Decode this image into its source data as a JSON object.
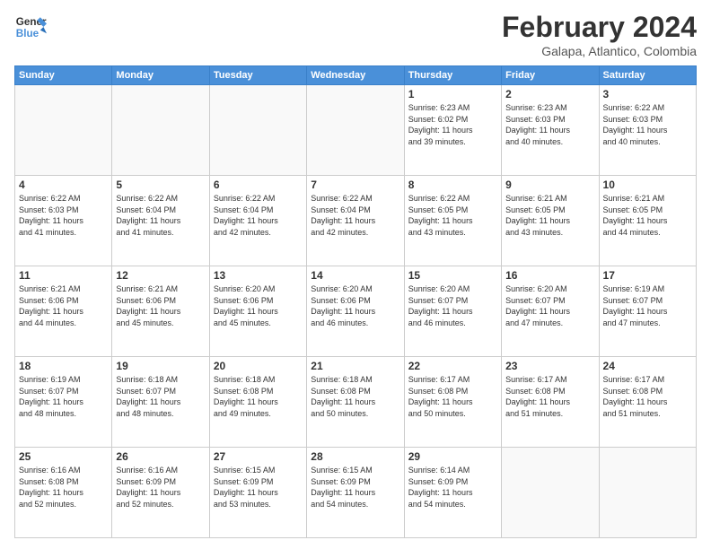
{
  "header": {
    "logo_line1": "General",
    "logo_line2": "Blue",
    "title": "February 2024",
    "subtitle": "Galapa, Atlantico, Colombia"
  },
  "days_of_week": [
    "Sunday",
    "Monday",
    "Tuesday",
    "Wednesday",
    "Thursday",
    "Friday",
    "Saturday"
  ],
  "weeks": [
    [
      {
        "day": "",
        "info": ""
      },
      {
        "day": "",
        "info": ""
      },
      {
        "day": "",
        "info": ""
      },
      {
        "day": "",
        "info": ""
      },
      {
        "day": "1",
        "info": "Sunrise: 6:23 AM\nSunset: 6:02 PM\nDaylight: 11 hours\nand 39 minutes."
      },
      {
        "day": "2",
        "info": "Sunrise: 6:23 AM\nSunset: 6:03 PM\nDaylight: 11 hours\nand 40 minutes."
      },
      {
        "day": "3",
        "info": "Sunrise: 6:22 AM\nSunset: 6:03 PM\nDaylight: 11 hours\nand 40 minutes."
      }
    ],
    [
      {
        "day": "4",
        "info": "Sunrise: 6:22 AM\nSunset: 6:03 PM\nDaylight: 11 hours\nand 41 minutes."
      },
      {
        "day": "5",
        "info": "Sunrise: 6:22 AM\nSunset: 6:04 PM\nDaylight: 11 hours\nand 41 minutes."
      },
      {
        "day": "6",
        "info": "Sunrise: 6:22 AM\nSunset: 6:04 PM\nDaylight: 11 hours\nand 42 minutes."
      },
      {
        "day": "7",
        "info": "Sunrise: 6:22 AM\nSunset: 6:04 PM\nDaylight: 11 hours\nand 42 minutes."
      },
      {
        "day": "8",
        "info": "Sunrise: 6:22 AM\nSunset: 6:05 PM\nDaylight: 11 hours\nand 43 minutes."
      },
      {
        "day": "9",
        "info": "Sunrise: 6:21 AM\nSunset: 6:05 PM\nDaylight: 11 hours\nand 43 minutes."
      },
      {
        "day": "10",
        "info": "Sunrise: 6:21 AM\nSunset: 6:05 PM\nDaylight: 11 hours\nand 44 minutes."
      }
    ],
    [
      {
        "day": "11",
        "info": "Sunrise: 6:21 AM\nSunset: 6:06 PM\nDaylight: 11 hours\nand 44 minutes."
      },
      {
        "day": "12",
        "info": "Sunrise: 6:21 AM\nSunset: 6:06 PM\nDaylight: 11 hours\nand 45 minutes."
      },
      {
        "day": "13",
        "info": "Sunrise: 6:20 AM\nSunset: 6:06 PM\nDaylight: 11 hours\nand 45 minutes."
      },
      {
        "day": "14",
        "info": "Sunrise: 6:20 AM\nSunset: 6:06 PM\nDaylight: 11 hours\nand 46 minutes."
      },
      {
        "day": "15",
        "info": "Sunrise: 6:20 AM\nSunset: 6:07 PM\nDaylight: 11 hours\nand 46 minutes."
      },
      {
        "day": "16",
        "info": "Sunrise: 6:20 AM\nSunset: 6:07 PM\nDaylight: 11 hours\nand 47 minutes."
      },
      {
        "day": "17",
        "info": "Sunrise: 6:19 AM\nSunset: 6:07 PM\nDaylight: 11 hours\nand 47 minutes."
      }
    ],
    [
      {
        "day": "18",
        "info": "Sunrise: 6:19 AM\nSunset: 6:07 PM\nDaylight: 11 hours\nand 48 minutes."
      },
      {
        "day": "19",
        "info": "Sunrise: 6:18 AM\nSunset: 6:07 PM\nDaylight: 11 hours\nand 48 minutes."
      },
      {
        "day": "20",
        "info": "Sunrise: 6:18 AM\nSunset: 6:08 PM\nDaylight: 11 hours\nand 49 minutes."
      },
      {
        "day": "21",
        "info": "Sunrise: 6:18 AM\nSunset: 6:08 PM\nDaylight: 11 hours\nand 50 minutes."
      },
      {
        "day": "22",
        "info": "Sunrise: 6:17 AM\nSunset: 6:08 PM\nDaylight: 11 hours\nand 50 minutes."
      },
      {
        "day": "23",
        "info": "Sunrise: 6:17 AM\nSunset: 6:08 PM\nDaylight: 11 hours\nand 51 minutes."
      },
      {
        "day": "24",
        "info": "Sunrise: 6:17 AM\nSunset: 6:08 PM\nDaylight: 11 hours\nand 51 minutes."
      }
    ],
    [
      {
        "day": "25",
        "info": "Sunrise: 6:16 AM\nSunset: 6:08 PM\nDaylight: 11 hours\nand 52 minutes."
      },
      {
        "day": "26",
        "info": "Sunrise: 6:16 AM\nSunset: 6:09 PM\nDaylight: 11 hours\nand 52 minutes."
      },
      {
        "day": "27",
        "info": "Sunrise: 6:15 AM\nSunset: 6:09 PM\nDaylight: 11 hours\nand 53 minutes."
      },
      {
        "day": "28",
        "info": "Sunrise: 6:15 AM\nSunset: 6:09 PM\nDaylight: 11 hours\nand 54 minutes."
      },
      {
        "day": "29",
        "info": "Sunrise: 6:14 AM\nSunset: 6:09 PM\nDaylight: 11 hours\nand 54 minutes."
      },
      {
        "day": "",
        "info": ""
      },
      {
        "day": "",
        "info": ""
      }
    ]
  ]
}
